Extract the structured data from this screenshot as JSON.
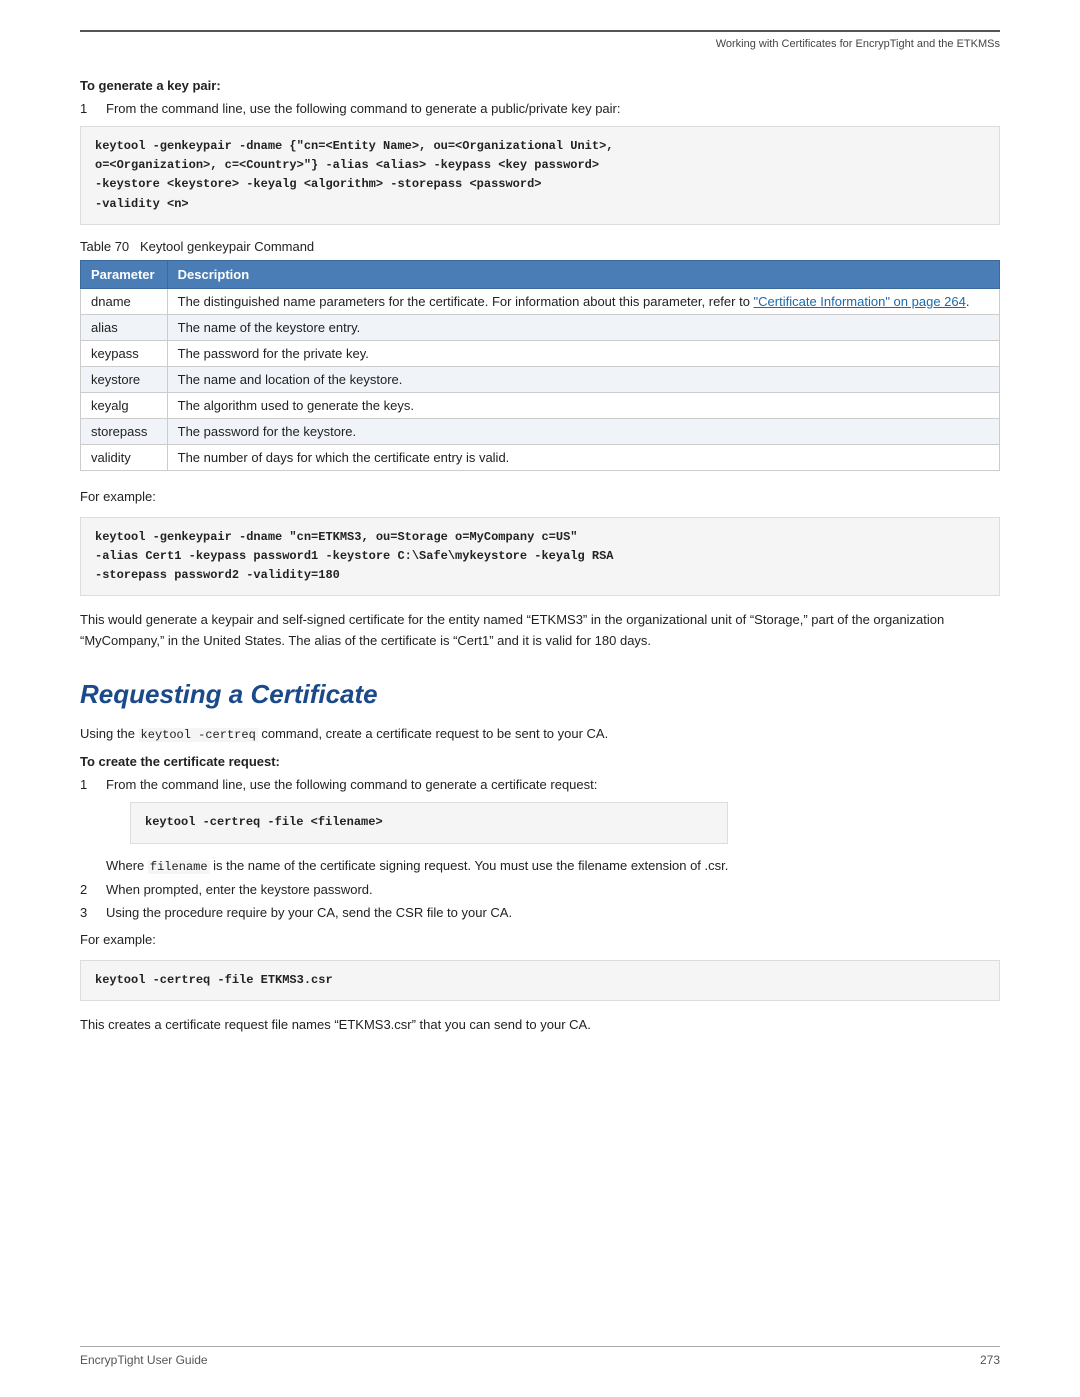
{
  "header": {
    "text": "Working with Certificates for EncrypTight and the ETKMSs"
  },
  "generate_keypair": {
    "heading": "To generate a key pair:",
    "step1_text": "From the command line, use the following command to generate a public/private key pair:",
    "code1": "keytool -genkeypair -dname {\"cn=<Entity Name>, ou=<Organizational Unit>,\no=<Organization>, c=<Country>\"} -alias <alias> -keypass <key password>\n-keystore <keystore> -keyalg <algorithm> -storepass <password>\n-validity <n>",
    "table_caption_num": "70",
    "table_caption_label": "Keytool genkeypair Command",
    "table_headers": [
      "Parameter",
      "Description"
    ],
    "table_rows": [
      {
        "param": "dname",
        "desc_before": "The distinguished name parameters for the certificate. For information about this parameter, refer to ",
        "desc_link": "\"Certificate Information\" on page 264",
        "desc_after": "."
      },
      {
        "param": "alias",
        "desc": "The name of the keystore entry."
      },
      {
        "param": "keypass",
        "desc": "The password for the private key."
      },
      {
        "param": "keystore",
        "desc": "The name and location of the keystore."
      },
      {
        "param": "keyalg",
        "desc": "The algorithm used to generate the keys."
      },
      {
        "param": "storepass",
        "desc": "The password for the keystore."
      },
      {
        "param": "validity",
        "desc": "The number of days for which the certificate entry is valid."
      }
    ],
    "for_example_label": "For example:",
    "code2": "keytool -genkeypair -dname \"cn=ETKMS3, ou=Storage o=MyCompany c=US\"\n-alias Cert1 -keypass password1 -keystore C:\\Safe\\mykeystore -keyalg RSA\n-storepass password2 -validity=180",
    "para1": "This would generate a keypair and self-signed certificate for the entity named “ETKMS3” in the organizational unit of “Storage,” part of the organization “MyCompany,” in the United States. The alias of the certificate is “Cert1” and it is valid for 180 days."
  },
  "requesting_cert": {
    "title": "Requesting a Certificate",
    "intro_before": "Using the ",
    "intro_code": "keytool -certreq",
    "intro_after": " command, create a certificate request to be sent to your CA.",
    "create_heading": "To create the certificate request:",
    "step1_text": "From the command line, use the following command to generate a certificate request:",
    "code1": "keytool -certreq -file <filename>",
    "where_before": "Where ",
    "where_code": "filename",
    "where_after": " is the name of the certificate signing request. You must use the filename extension of .csr.",
    "step2_text": "When prompted, enter the keystore password.",
    "step3_text": "Using the procedure require by your CA, send the CSR file to your CA.",
    "for_example_label": "For example:",
    "code2": "keytool -certreq -file ETKMS3.csr",
    "para1": "This creates a certificate request file names “ETKMS3.csr” that you can send to your CA."
  },
  "footer": {
    "left": "EncrypTight User Guide",
    "right": "273"
  }
}
